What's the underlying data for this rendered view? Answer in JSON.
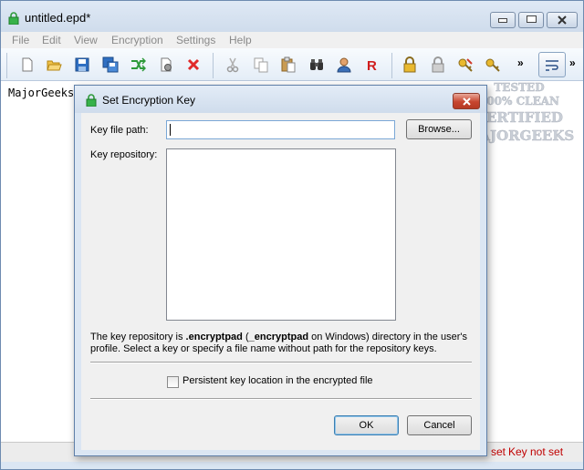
{
  "window": {
    "title": "untitled.epd*",
    "editor_text": "MajorGeeks",
    "menu": [
      "File",
      "Edit",
      "View",
      "Encryption",
      "Settings",
      "Help"
    ],
    "toolbar_overflow": "»",
    "status_fragment": "set",
    "status_key": "Key not set",
    "status_color": "#c00000"
  },
  "dialog": {
    "title": "Set Encryption Key",
    "key_file_path_label": "Key file path:",
    "key_file_path_value": "",
    "browse_label": "Browse...",
    "key_repository_label": "Key repository:",
    "info_part1": "The key repository is ",
    "info_bold1": ".encryptpad",
    "info_part2": " (",
    "info_bold2": "_encryptpad",
    "info_part3": " on Windows) directory in the user's profile. Select a key or specify a file name without path for the repository keys.",
    "persistent_label": "Persistent key location in the encrypted file",
    "persistent_checked": false,
    "ok_label": "OK",
    "cancel_label": "Cancel"
  },
  "watermark": {
    "line1": "TESTED",
    "line2": "100% CLEAN",
    "line3": "CERTIFIED",
    "line4": "MAJORGEEKS"
  },
  "icons": [
    "app-lock-icon",
    "new-file-icon",
    "open-folder-icon",
    "save-icon",
    "save-as-icon",
    "encrypt-shuffle-icon",
    "settings-page-icon",
    "delete-x-icon",
    "cut-icon",
    "copy-icon",
    "paste-icon",
    "binoculars-icon",
    "user-icon",
    "r-icon",
    "lock-icon",
    "gray-lock-icon",
    "key-edit-icon",
    "key-icon",
    "word-wrap-icon"
  ]
}
